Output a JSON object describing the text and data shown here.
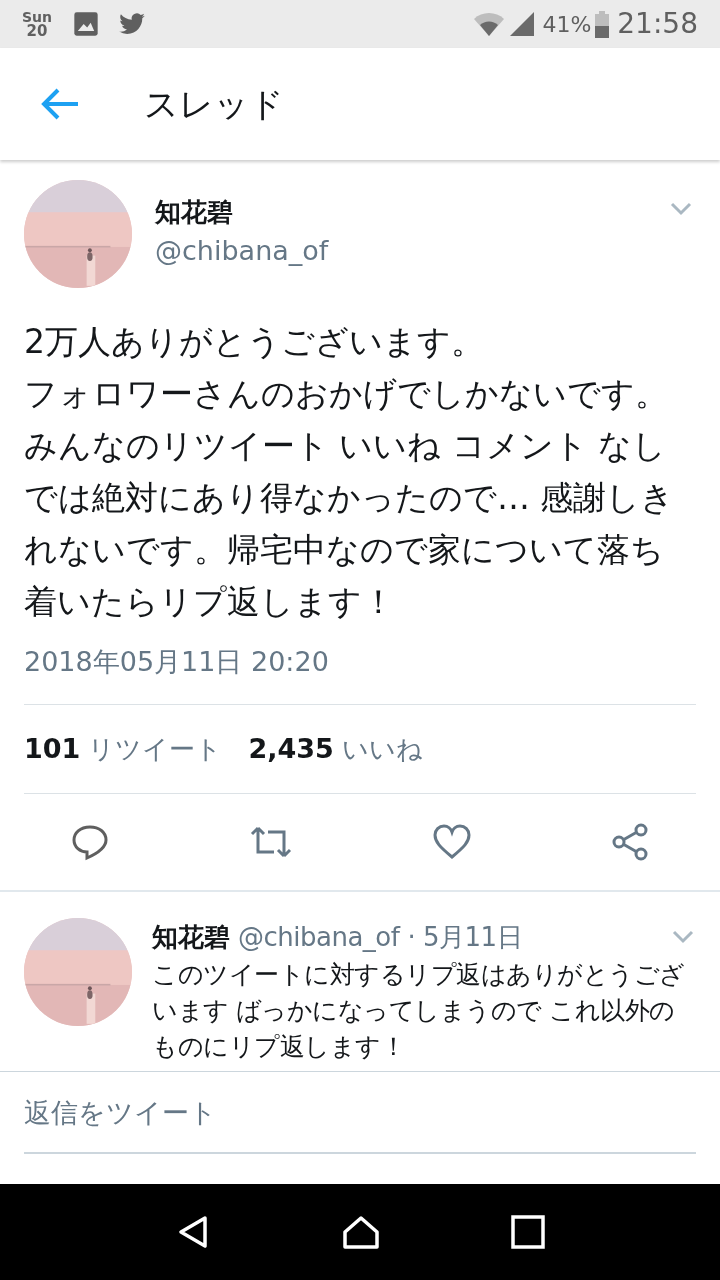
{
  "status_bar": {
    "day": "Sun",
    "date": "20",
    "battery": "41%",
    "time": "21:58"
  },
  "header": {
    "title": "スレッド"
  },
  "tweet": {
    "name": "知花碧",
    "handle": "@chibana_of",
    "paragraphs": [
      "2万人ありがとうございます。",
      "フォロワーさんのおかげでしかないです。みんなのリツイート いいね コメント なしでは絶対にあり得なかったので… 感謝しきれないです。帰宅中なので家について落ち着いたらリプ返します！"
    ],
    "timestamp": "2018年05月11日 20:20",
    "stats": [
      {
        "count": "101",
        "label": "リツイート"
      },
      {
        "count": "2,435",
        "label": "いいね"
      }
    ]
  },
  "actions": [
    {
      "kind": "reply"
    },
    {
      "kind": "retweet"
    },
    {
      "kind": "like"
    },
    {
      "kind": "share"
    }
  ],
  "replies": [
    {
      "name": "知花碧",
      "handle": "@chibana_of",
      "date": "· 5月11日",
      "text": "このツイートに対するリプ返はありがとうございます ばっかになってしまうので これ以外のものにリプ返します！"
    }
  ],
  "compose": {
    "placeholder": "返信をツイート"
  }
}
